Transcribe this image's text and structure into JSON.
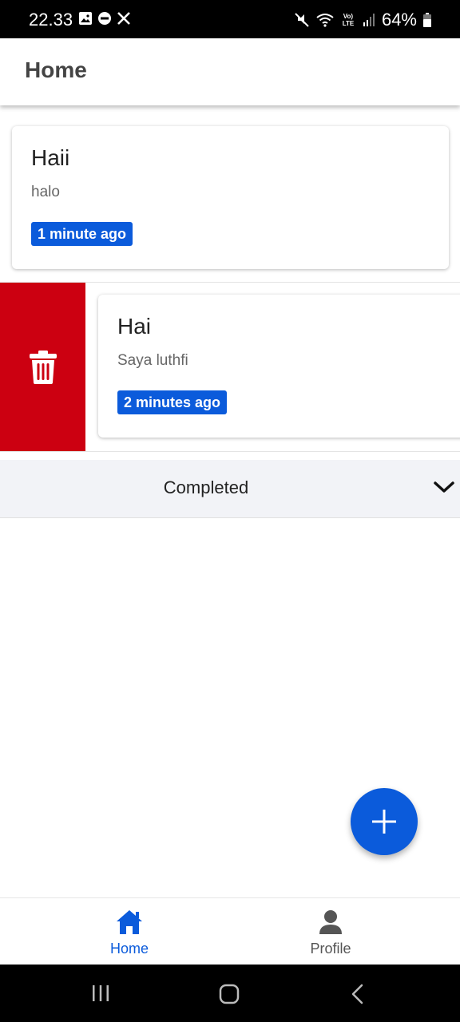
{
  "status_bar": {
    "time": "22.33",
    "battery": "64%",
    "network": "Vo) LTE"
  },
  "app_bar": {
    "title": "Home"
  },
  "notes": [
    {
      "title": "Haii",
      "description": "halo",
      "time_badge": "1 minute ago"
    },
    {
      "title": "Hai",
      "description": "Saya luthfi",
      "time_badge": "2 minutes ago"
    }
  ],
  "completed_section": {
    "label": "Completed"
  },
  "bottom_nav": {
    "items": [
      {
        "label": "Home"
      },
      {
        "label": "Profile"
      }
    ]
  },
  "colors": {
    "accent": "#0b5bdb",
    "delete": "#cc0011",
    "section_bg": "#f2f3f7"
  },
  "icons": {
    "status_left": [
      "image-icon",
      "do-not-disturb-icon",
      "x-logo-icon"
    ],
    "status_right": [
      "mute-icon",
      "wifi-icon",
      "signal-icon",
      "battery-icon"
    ],
    "delete": "trash-icon",
    "expand": "chevron-down-icon",
    "fab": "plus-icon",
    "nav": [
      "home-icon",
      "person-icon"
    ]
  }
}
